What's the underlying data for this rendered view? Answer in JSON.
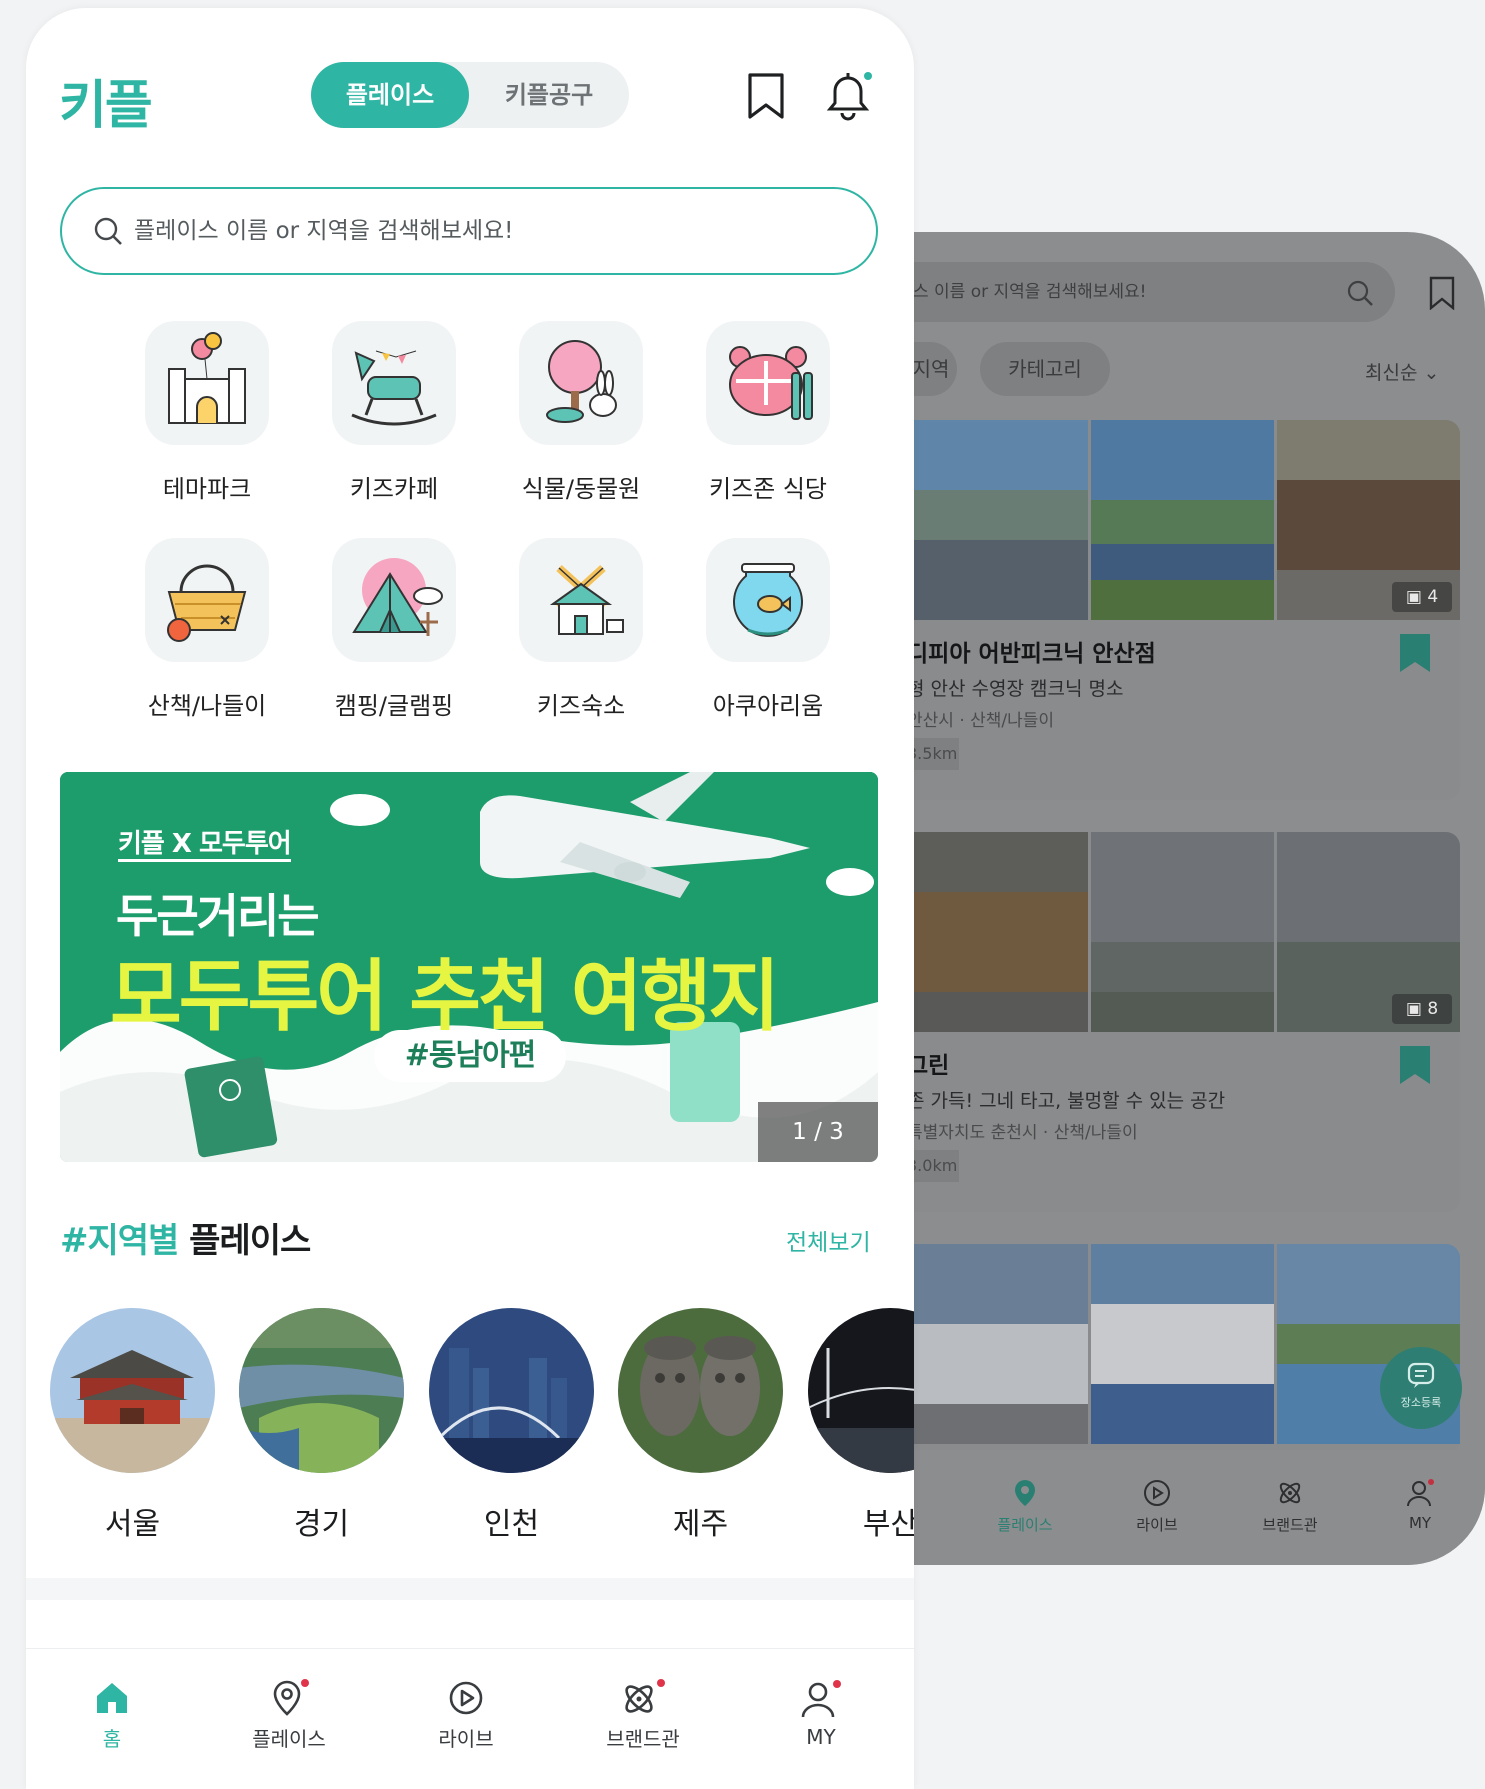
{
  "front": {
    "logo": "키플",
    "segment": {
      "active": "플레이스",
      "inactive": "키플공구"
    },
    "search_placeholder": "플레이스 이름 or 지역을 검색해보세요!",
    "categories": [
      {
        "label": "테마파크",
        "icon": "castle-balloon-icon"
      },
      {
        "label": "키즈카페",
        "icon": "rocking-horse-icon"
      },
      {
        "label": "식물/동물원",
        "icon": "tree-rabbit-icon"
      },
      {
        "label": "키즈존 식당",
        "icon": "plate-cutlery-icon"
      },
      {
        "label": "산책/나들이",
        "icon": "picnic-basket-icon"
      },
      {
        "label": "캠핑/글램핑",
        "icon": "tent-icon"
      },
      {
        "label": "키즈숙소",
        "icon": "windmill-house-icon"
      },
      {
        "label": "아쿠아리움",
        "icon": "fishbowl-icon"
      }
    ],
    "banner": {
      "subtitle": "키플 X 모두투어",
      "line1": "두근거리는",
      "line2": "모두투어 추천 여행지",
      "tag": "#동남아편",
      "page": "1 / 3"
    },
    "section": {
      "hash": "#지역별",
      "title": "플레이스",
      "more": "전체보기"
    },
    "regions": [
      "서울",
      "경기",
      "인천",
      "제주",
      "부산"
    ],
    "nav": [
      "홈",
      "플레이스",
      "라이브",
      "브랜드관",
      "MY"
    ]
  },
  "back": {
    "search_placeholder": "스 이름 or 지역을 검색해보세요!",
    "chips": [
      "지역",
      "카테고리"
    ],
    "sort": "최신순",
    "cards": [
      {
        "photo_count": "4",
        "title": "디피아 어반피크닉 안산점",
        "desc": "형 안산 수영장 캠크닉 명소",
        "addr": "안산시 · 산책/나들이",
        "dist": "3.5km"
      },
      {
        "photo_count": "8",
        "title": "그린",
        "desc": "존 가득! 그네 타고, 불멍할 수 있는 공간",
        "addr": "특별자치도 춘천시 · 산책/나들이",
        "dist": "3.0km"
      },
      {
        "photo_count": ""
      }
    ],
    "fab": "장소등록",
    "nav": [
      "플레이스",
      "라이브",
      "브랜드관",
      "MY"
    ]
  },
  "colors": {
    "brand": "#2fb5a3",
    "banner_bg": "#1d9c6c",
    "banner_accent": "#e6f541",
    "notify_dot": "#e0344a"
  }
}
